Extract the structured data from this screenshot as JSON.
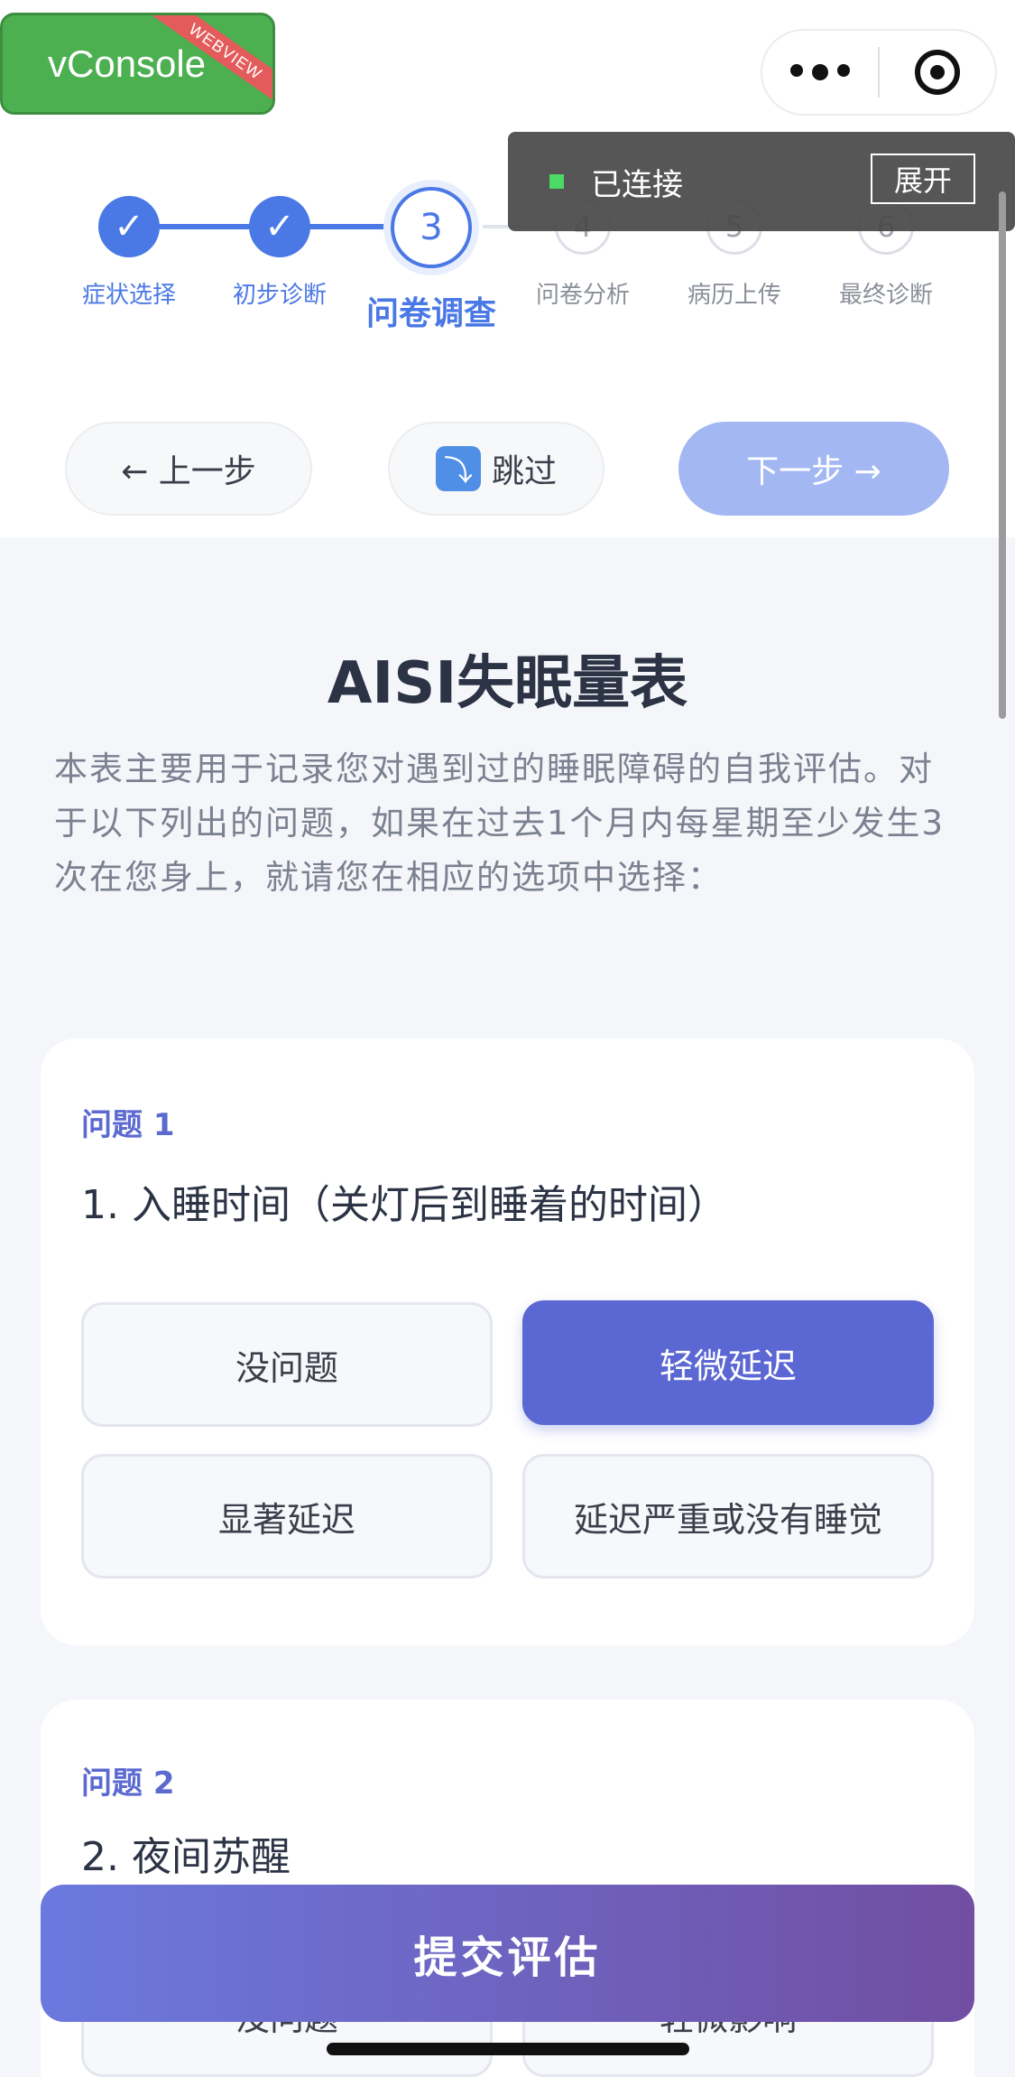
{
  "vconsole": {
    "label": "vConsole",
    "ribbon": "WEBVIEW"
  },
  "steps": [
    {
      "number": "1",
      "label": "症状选择",
      "state": "done"
    },
    {
      "number": "2",
      "label": "初步诊断",
      "state": "done"
    },
    {
      "number": "3",
      "label": "问卷调查",
      "state": "current"
    },
    {
      "number": "4",
      "label": "问卷分析",
      "state": "todo"
    },
    {
      "number": "5",
      "label": "病历上传",
      "state": "todo"
    },
    {
      "number": "6",
      "label": "最终诊断",
      "state": "todo"
    }
  ],
  "done_mark": "✓",
  "vc_panel": {
    "status": "已连接",
    "expand": "展开"
  },
  "nav": {
    "prev": "← 上一步",
    "skip": "跳过",
    "skip_icon": "⤵",
    "next": "下一步 →"
  },
  "scale": {
    "title": "AISI失眠量表",
    "description": "本表主要用于记录您对遇到过的睡眠障碍的自我评估。对于以下列出的问题，如果在过去1个月内每星期至少发生3次在您身上，就请您在相应的选项中选择："
  },
  "questions": [
    {
      "tag": "问题 1",
      "text": "1. 入睡时间（关灯后到睡着的时间）",
      "options": [
        "没问题",
        "轻微延迟",
        "显著延迟",
        "延迟严重或没有睡觉"
      ],
      "selected_index": 1
    },
    {
      "tag": "问题 2",
      "text": "2. 夜间苏醒",
      "options": [
        "没问题",
        "轻微影响"
      ]
    }
  ],
  "submit": "提交评估",
  "colors": {
    "primary": "#4a78e5",
    "selected": "#5b67d2",
    "next_disabled": "#a3b8f3",
    "vconsole": "#4caf50"
  }
}
